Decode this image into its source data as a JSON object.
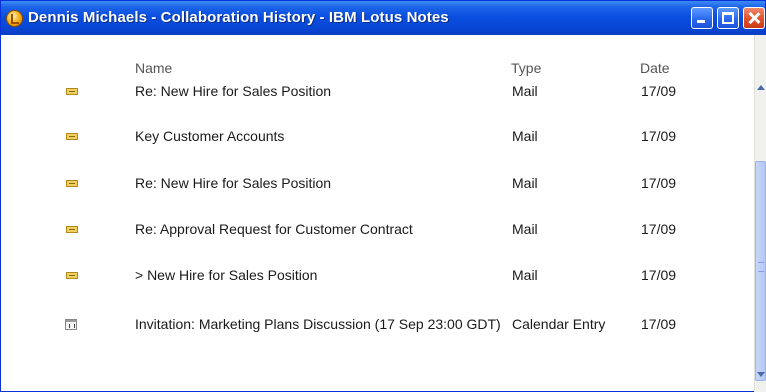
{
  "window": {
    "title": "Dennis Michaels - Collaboration History - IBM Lotus Notes",
    "controls": [
      "minimize",
      "maximize",
      "close"
    ]
  },
  "columns": {
    "name": "Name",
    "type": "Type",
    "date": "Date"
  },
  "rows": [
    {
      "icon": "mail-icon",
      "name": "Re: New Hire for Sales Position",
      "type": "Mail",
      "date": "17/09"
    },
    {
      "icon": "mail-icon",
      "name": "Key Customer Accounts",
      "type": "Mail",
      "date": "17/09"
    },
    {
      "icon": "mail-icon",
      "name": "Re: New Hire for Sales Position",
      "type": "Mail",
      "date": "17/09"
    },
    {
      "icon": "mail-icon",
      "name": "Re: Approval Request for Customer Contract",
      "type": "Mail",
      "date": "17/09"
    },
    {
      "icon": "mail-icon",
      "name": "> New Hire for Sales Position",
      "type": "Mail",
      "date": "17/09"
    },
    {
      "icon": "calendar-icon",
      "name": "Invitation: Marketing Plans Discussion (17 Sep 23:00 GDT)",
      "type": "Calendar Entry",
      "date": "17/09"
    }
  ]
}
